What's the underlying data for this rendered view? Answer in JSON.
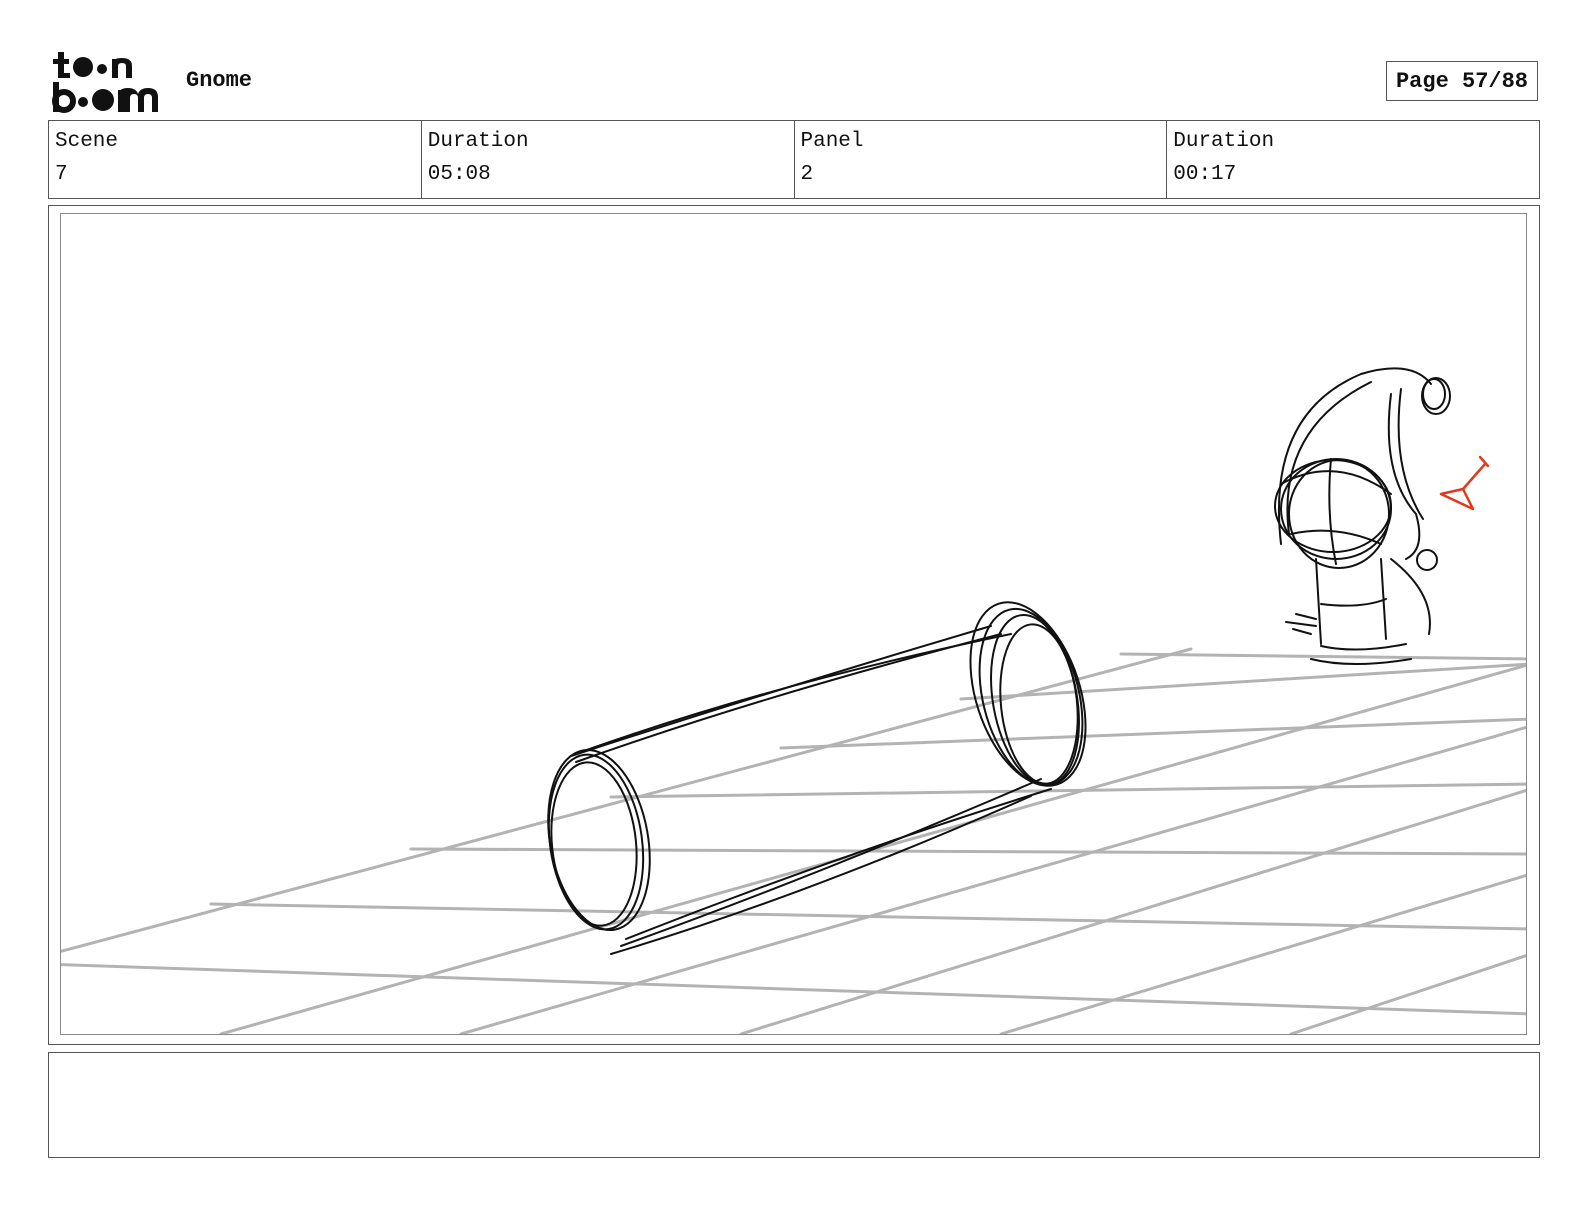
{
  "header": {
    "logo_icon": "toon-boom-logo",
    "project_title": "Gnome",
    "page_label": "Page 57/88"
  },
  "info": {
    "scene_label": "Scene",
    "scene_value": "7",
    "scene_duration_label": "Duration",
    "scene_duration_value": "05:08",
    "panel_label": "Panel",
    "panel_value": "2",
    "panel_duration_label": "Duration",
    "panel_duration_value": "00:17"
  },
  "panel": {
    "sketch": "storyboard-sketch",
    "grid_color": "#b3b3b3",
    "ink_color": "#111111",
    "annotation_color": "#e03a1e"
  },
  "notes": {
    "text": ""
  }
}
